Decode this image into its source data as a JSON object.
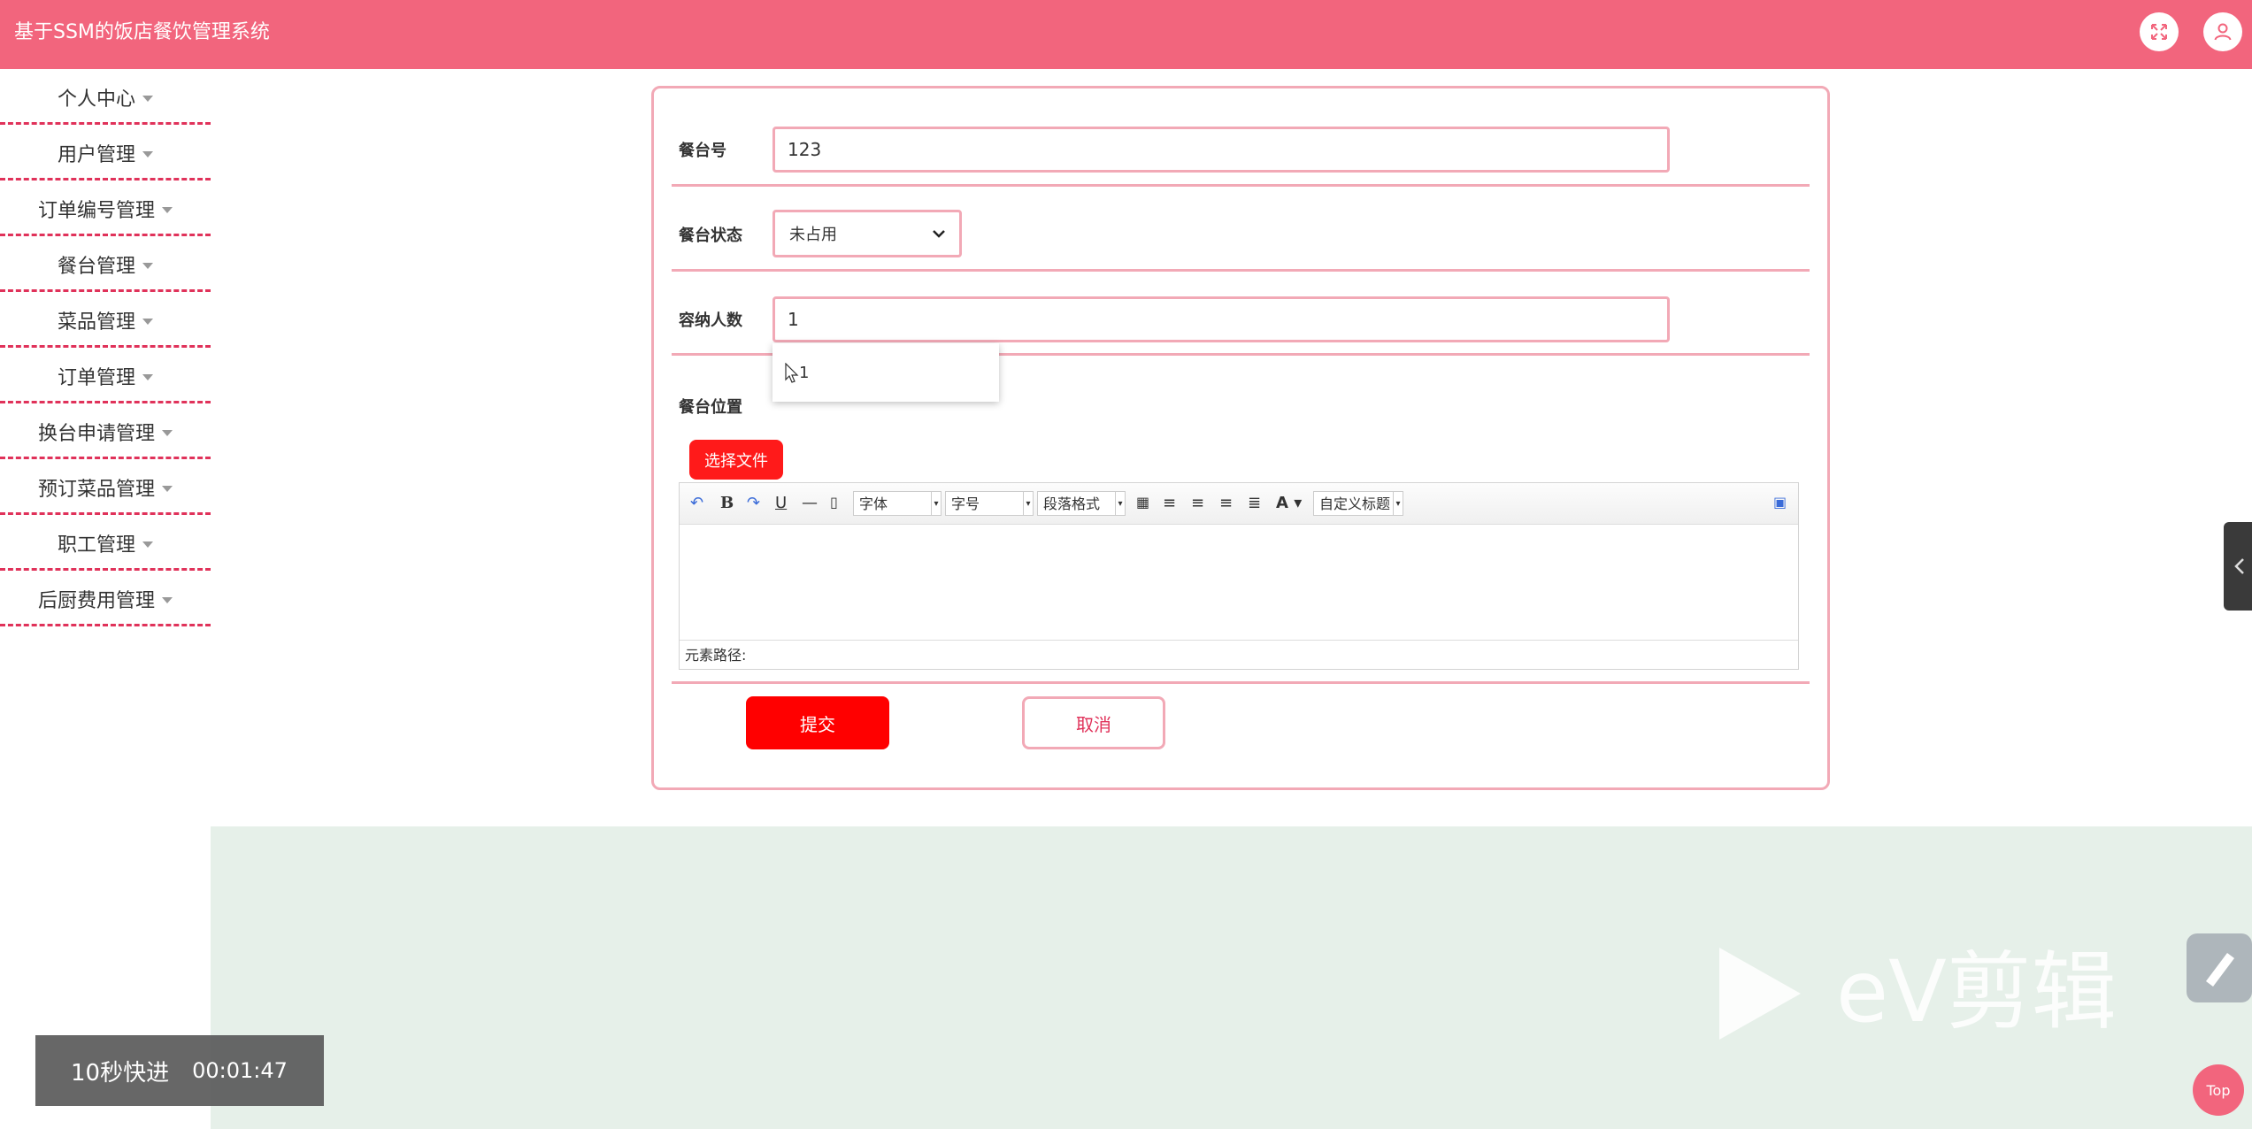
{
  "header": {
    "title": "基于SSM的饭店餐饮管理系统",
    "fullscreen_icon": "expand-icon",
    "user_icon": "user-icon"
  },
  "sidebar": {
    "items": [
      {
        "label": "个人中心"
      },
      {
        "label": "用户管理"
      },
      {
        "label": "订单编号管理"
      },
      {
        "label": "餐台管理"
      },
      {
        "label": "菜品管理"
      },
      {
        "label": "订单管理"
      },
      {
        "label": "换台申请管理"
      },
      {
        "label": "预订菜品管理"
      },
      {
        "label": "职工管理"
      },
      {
        "label": "后厨费用管理"
      }
    ]
  },
  "form": {
    "table_no": {
      "label": "餐台号",
      "value": "123"
    },
    "status": {
      "label": "餐台状态",
      "value": "未占用"
    },
    "capacity": {
      "label": "容纳人数",
      "value": "1",
      "suggestion": "1"
    },
    "location": {
      "label": "餐台位置",
      "file_button": "选择文件"
    },
    "editor": {
      "font_family": "字体",
      "font_size": "字号",
      "paragraph": "段落格式",
      "custom_title": "自定义标题",
      "element_path": "元素路径:",
      "color_letter": "A"
    },
    "submit": "提交",
    "cancel": "取消"
  },
  "overlay": {
    "label": "10秒快进",
    "time": "00:01:47"
  },
  "watermark": {
    "text": "eV剪辑"
  },
  "top_button": "Top",
  "colors": {
    "header": "#f2657d",
    "accent_red": "#ff0000",
    "border_pink": "#f2a9b6",
    "dash": "#e0325a",
    "green_bg": "#e6f0e9"
  }
}
